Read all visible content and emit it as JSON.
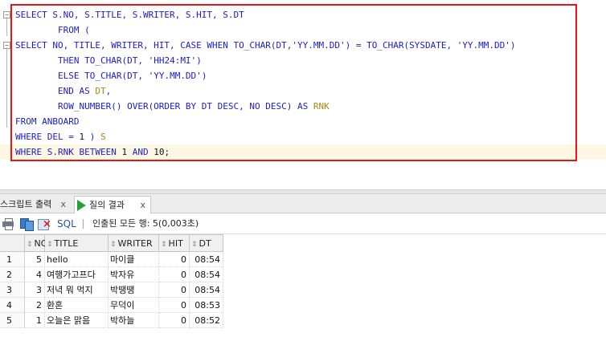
{
  "editor": {
    "lines": [
      [
        [
          "kw",
          "SELECT S.NO, S.TITLE, S.WRITER, S.HIT, S.DT"
        ]
      ],
      [
        [
          "kw",
          "        FROM ("
        ]
      ],
      [
        [
          "kw",
          "SELECT NO, TITLE, WRITER, HIT, CASE WHEN TO_CHAR(DT,"
        ],
        [
          "str",
          "'YY.MM.DD'"
        ],
        [
          "kw",
          ") = TO_CHAR(SYSDATE, "
        ],
        [
          "str",
          "'YY.MM.DD'"
        ],
        [
          "kw",
          ")"
        ]
      ],
      [
        [
          "kw",
          "        THEN TO_CHAR(DT, "
        ],
        [
          "str",
          "'HH24:MI'"
        ],
        [
          "kw",
          ")"
        ]
      ],
      [
        [
          "kw",
          "        ELSE TO_CHAR(DT, "
        ],
        [
          "str",
          "'YY.MM.DD'"
        ],
        [
          "kw",
          ")"
        ]
      ],
      [
        [
          "kw",
          "        END AS "
        ],
        [
          "al",
          "DT"
        ],
        [
          "kw",
          ","
        ]
      ],
      [
        [
          "kw",
          "        ROW_NUMBER() OVER(ORDER BY DT DESC, NO DESC) AS "
        ],
        [
          "al",
          "RNK"
        ]
      ],
      [
        [
          "kw",
          "FROM ANBOARD"
        ]
      ],
      [
        [
          "kw",
          "WHERE DEL = "
        ],
        [
          "num",
          "1"
        ],
        [
          "kw",
          " ) "
        ],
        [
          "al",
          "S"
        ]
      ],
      [
        [
          "kw",
          "WHERE S.RNK BETWEEN "
        ],
        [
          "num",
          "1"
        ],
        [
          "kw",
          " AND "
        ],
        [
          "num",
          "10"
        ],
        [
          "pl",
          ";"
        ]
      ]
    ],
    "fold_markers": [
      "−",
      "−"
    ]
  },
  "tabs": {
    "script_output": "스크립트 출력",
    "script_output_close": "x",
    "query_result": "질의 결과",
    "query_result_close": "x"
  },
  "toolbar": {
    "sql_label": "SQL",
    "separator": "|",
    "status": "인출된 모든 행: 5(0,003초)"
  },
  "grid": {
    "sort_glyph": "⇕",
    "columns": [
      "NO",
      "TITLE",
      "WRITER",
      "HIT",
      "DT"
    ],
    "rows": [
      {
        "row": "1",
        "no": "5",
        "title": "hello",
        "writer": "마이클",
        "hit": "0",
        "dt": "08:54"
      },
      {
        "row": "2",
        "no": "4",
        "title": "여행가고프다",
        "writer": "박자유",
        "hit": "0",
        "dt": "08:54"
      },
      {
        "row": "3",
        "no": "3",
        "title": "저녁 뭐 먹지",
        "writer": "박땡땡",
        "hit": "0",
        "dt": "08:54"
      },
      {
        "row": "4",
        "no": "2",
        "title": "환혼",
        "writer": "무덕이",
        "hit": "0",
        "dt": "08:53"
      },
      {
        "row": "5",
        "no": "1",
        "title": "오늘은 맑음",
        "writer": "박하늘",
        "hit": "0",
        "dt": "08:52"
      }
    ]
  }
}
